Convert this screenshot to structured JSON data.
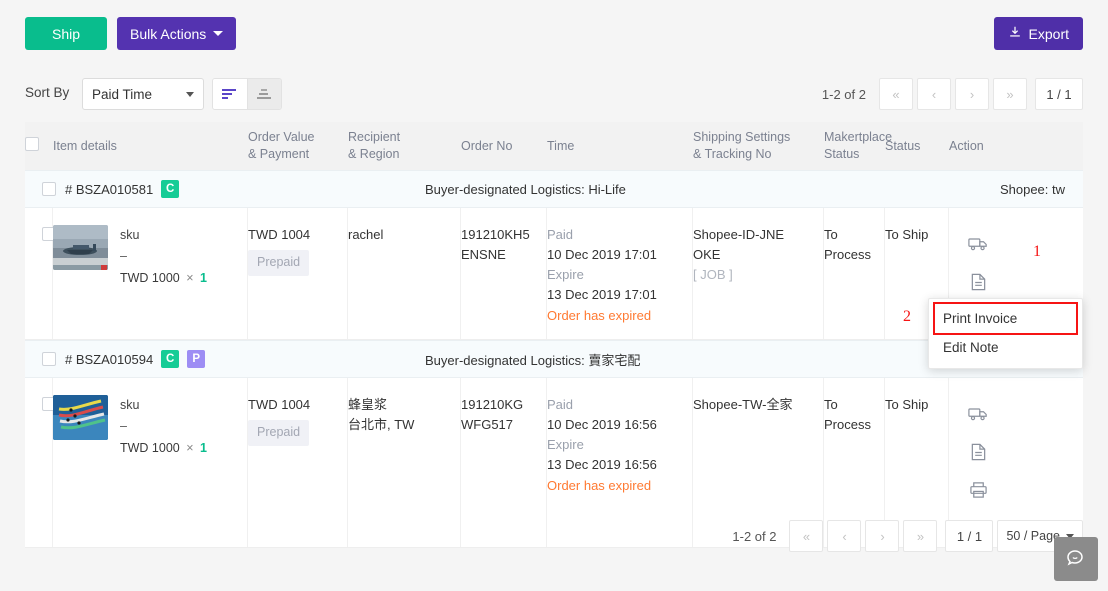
{
  "toolbar": {
    "ship_label": "Ship",
    "bulk_actions_label": "Bulk Actions",
    "export_label": "Export",
    "export_icon": "download-icon"
  },
  "sort": {
    "label": "Sort By",
    "selected": "Paid Time",
    "options": [
      "Paid Time"
    ],
    "desc_icon": "sort-descending-icon",
    "asc_icon": "sort-ascending-icon"
  },
  "pagination_top": {
    "range": "1-2 of 2",
    "first": "«",
    "prev": "‹",
    "next": "›",
    "last": "»",
    "page": "1 / 1"
  },
  "pagination_bottom": {
    "range": "1-2 of 2",
    "first": "«",
    "prev": "‹",
    "next": "›",
    "last": "»",
    "page": "1 / 1",
    "per_page": "50 / Page"
  },
  "table": {
    "headers": {
      "item_details": "Item details",
      "order_value_l1": "Order Value",
      "order_value_l2": "& Payment",
      "recipient_l1": "Recipient",
      "recipient_l2": "& Region",
      "order_no": "Order No",
      "time": "Time",
      "shipping_l1": "Shipping Settings",
      "shipping_l2": "& Tracking No",
      "marketplace_l1": "Makertplace",
      "marketplace_l2": "Status",
      "status": "Status",
      "action": "Action"
    },
    "orders": [
      {
        "order_id": "# BSZA010581",
        "badges": [
          "C"
        ],
        "logistics": "Buyer-designated Logistics: Hi-Life",
        "shop": "Shopee: tw",
        "item": {
          "sku_label": "sku",
          "dash": "–",
          "price": "TWD 1000",
          "times_symbol": "×",
          "qty": "1",
          "thumb_icon": "product-thumbnail-airplane"
        },
        "order_value": "TWD 1004",
        "payment": "Prepaid",
        "recipient": "rachel",
        "region": "",
        "order_no_l1": "191210KH5",
        "order_no_l2": "ENSNE",
        "time": {
          "paid_label": "Paid",
          "paid_value": "10 Dec 2019 17:01",
          "expire_label": "Expire",
          "expire_value": "13 Dec 2019 17:01",
          "note": "Order has expired"
        },
        "shipping_l1": "Shopee-ID-JNE",
        "shipping_l2": "OKE",
        "tracking": "[ JOB ]",
        "marketplace_status": "To Process",
        "status": "To Ship",
        "actions": [
          "truck-icon",
          "document-icon",
          "printer-icon",
          "more-options-icon"
        ]
      },
      {
        "order_id": "# BSZA010594",
        "badges": [
          "C",
          "P"
        ],
        "logistics": "Buyer-designated Logistics: 賣家宅配",
        "shop": "",
        "item": {
          "sku_label": "sku",
          "dash": "–",
          "price": "TWD 1000",
          "times_symbol": "×",
          "qty": "1",
          "thumb_icon": "product-thumbnail-jets"
        },
        "order_value": "TWD 1004",
        "payment": "Prepaid",
        "recipient": "蜂皇浆",
        "region": "台北市, TW",
        "order_no_l1": "191210KG",
        "order_no_l2": "WFG517",
        "time": {
          "paid_label": "Paid",
          "paid_value": "10 Dec 2019 16:56",
          "expire_label": "Expire",
          "expire_value": "13 Dec 2019 16:56",
          "note": "Order has expired"
        },
        "shipping_l1": "Shopee-TW-全家",
        "shipping_l2": "",
        "tracking": "",
        "marketplace_status": "To Process",
        "status": "To Ship",
        "actions": [
          "truck-icon",
          "document-icon",
          "printer-icon",
          "more-options-icon"
        ]
      }
    ]
  },
  "dropdown_menu": {
    "items": [
      {
        "label": "Print Invoice",
        "highlighted": true
      },
      {
        "label": "Edit Note",
        "highlighted": false
      }
    ]
  },
  "annotations": {
    "step1": "1",
    "step2": "2"
  },
  "chat": {
    "icon": "chat-bubble-icon"
  },
  "colors": {
    "ship_green": "#09bd8d",
    "bulk_purple": "#5433b0",
    "export_purple": "#4f2fa8",
    "badge_c_green": "#16cc96",
    "badge_p_purple": "#9d8df4",
    "expired_orange": "#ff7a32",
    "annotation_red": "#f61414"
  }
}
